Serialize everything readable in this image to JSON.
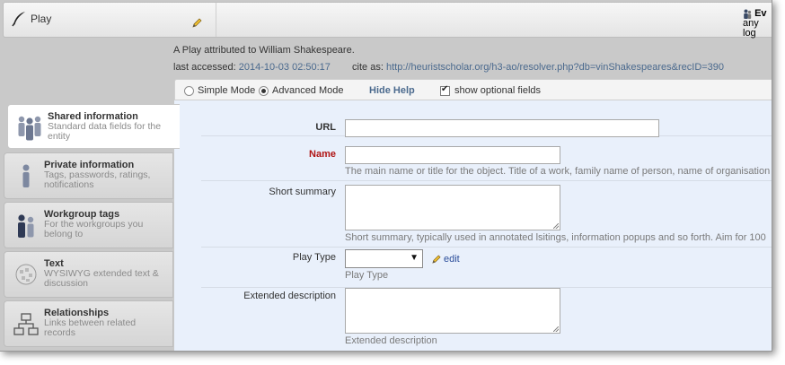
{
  "header": {
    "title": "Play",
    "user_line1": "Ev",
    "user_line2": "any log"
  },
  "record": {
    "description": "A Play attributed to William Shakespeare.",
    "last_accessed_label": "last accessed:",
    "last_accessed_value": "2014-10-03 02:50:17",
    "cite_label": "cite as:",
    "cite_value": "http://heuristscholar.org/h3-ao/resolver.php?db=vinShakespeares&recID=390"
  },
  "modebar": {
    "simple_mode": "Simple Mode",
    "advanced_mode": "Advanced Mode",
    "selected_mode": "advanced",
    "hide_help": "Hide Help",
    "show_optional": "show optional fields",
    "show_optional_checked": true
  },
  "tabs": [
    {
      "name": "Shared information",
      "desc": "Standard data fields for the entity",
      "icon": "group-icon",
      "active": true
    },
    {
      "name": "Private information",
      "desc": "Tags, passwords, ratings, notifications",
      "icon": "person-icon",
      "active": false
    },
    {
      "name": "Workgroup tags",
      "desc": "For the workgroups you belong to",
      "icon": "workgroup-icon",
      "active": false
    },
    {
      "name": "Text",
      "desc": "WYSIWYG extended text & discussion",
      "icon": "wiki-globe-icon",
      "active": false
    },
    {
      "name": "Relationships",
      "desc": "Links between related records",
      "icon": "hierarchy-icon",
      "active": false
    }
  ],
  "fields": {
    "url": {
      "label": "URL",
      "value": ""
    },
    "name": {
      "label": "Name",
      "value": "",
      "help": "The main name or title for the object. Title of a work, family name of person, name of organisation"
    },
    "short_summary": {
      "label": "Short summary",
      "value": "",
      "help": "Short summary, typically used in annotated lsitings, information popups and so forth. Aim for 100"
    },
    "play_type": {
      "label": "Play Type",
      "value": "",
      "help": "Play Type",
      "edit_label": "edit"
    },
    "extended_description": {
      "label": "Extended description",
      "value": "",
      "help": "Extended description"
    }
  },
  "colors": {
    "link_blue": "#4b6a8e",
    "required_red": "#b01515",
    "form_bg": "#e9f0fb"
  }
}
